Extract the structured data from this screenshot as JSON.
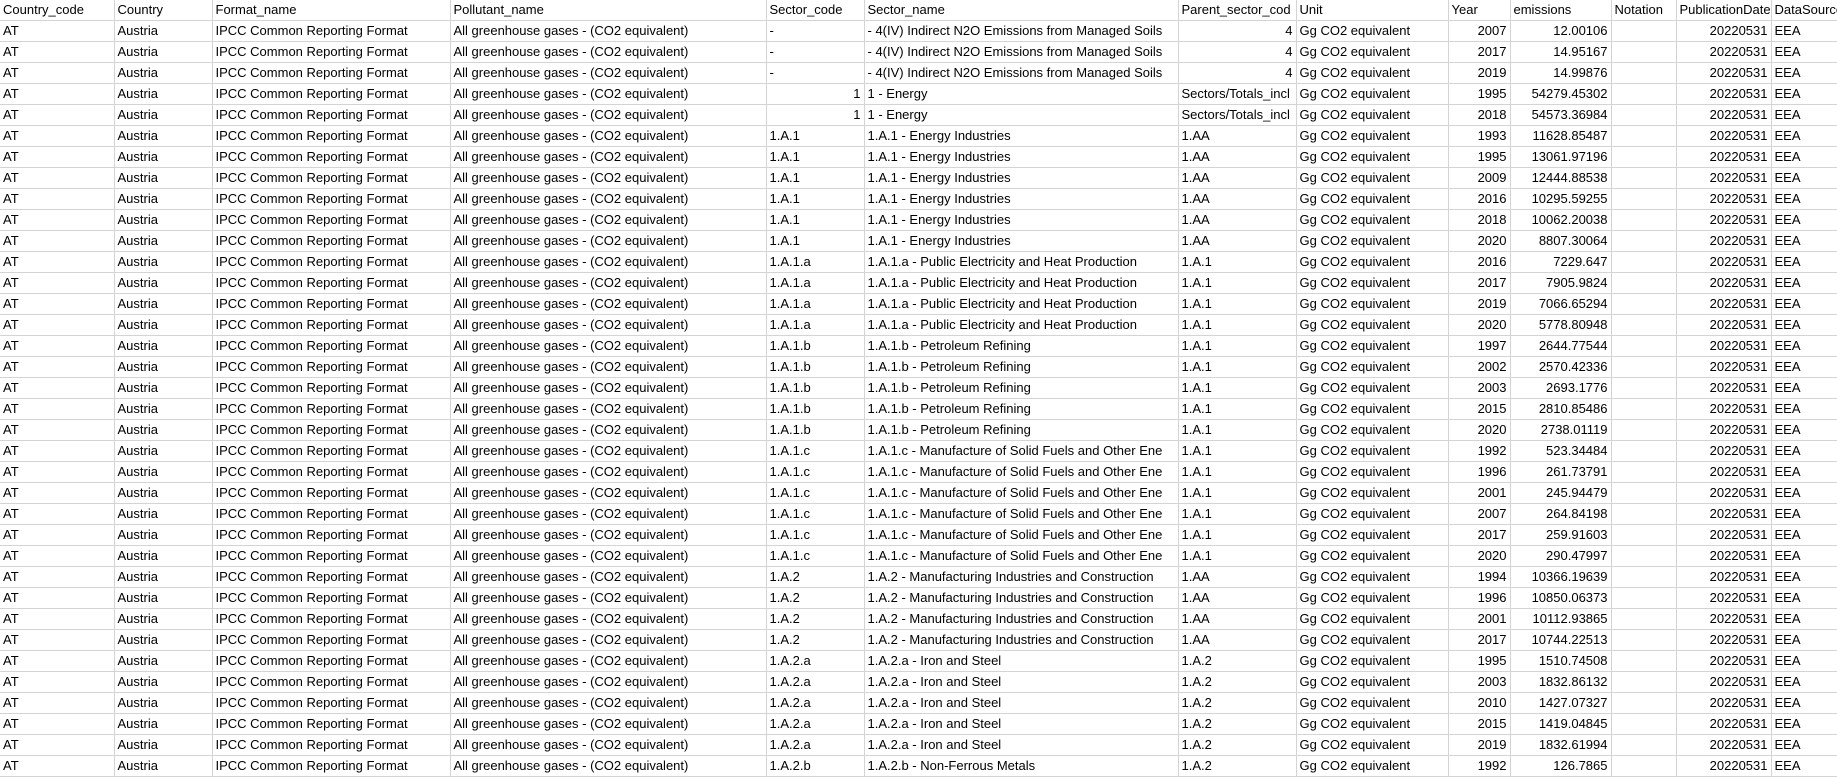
{
  "headers": [
    "Country_code",
    "Country",
    "Format_name",
    "Pollutant_name",
    "Sector_code",
    "Sector_name",
    "Parent_sector_cod",
    "Unit",
    "Year",
    "emissions",
    "Notation",
    "PublicationDate",
    "DataSource"
  ],
  "rows": [
    [
      "AT",
      "Austria",
      "IPCC Common Reporting Format",
      "All greenhouse gases - (CO2 equivalent)",
      "-",
      "- 4(IV)  Indirect N2O Emissions from Managed Soils",
      "4",
      "Gg CO2 equivalent",
      "2007",
      "12.00106",
      "",
      "20220531",
      "EEA"
    ],
    [
      "AT",
      "Austria",
      "IPCC Common Reporting Format",
      "All greenhouse gases - (CO2 equivalent)",
      "-",
      "- 4(IV)  Indirect N2O Emissions from Managed Soils",
      "4",
      "Gg CO2 equivalent",
      "2017",
      "14.95167",
      "",
      "20220531",
      "EEA"
    ],
    [
      "AT",
      "Austria",
      "IPCC Common Reporting Format",
      "All greenhouse gases - (CO2 equivalent)",
      "-",
      "- 4(IV)  Indirect N2O Emissions from Managed Soils",
      "4",
      "Gg CO2 equivalent",
      "2019",
      "14.99876",
      "",
      "20220531",
      "EEA"
    ],
    [
      "AT",
      "Austria",
      "IPCC Common Reporting Format",
      "All greenhouse gases - (CO2 equivalent)",
      "1",
      "1 - Energy",
      "Sectors/Totals_incl",
      "Gg CO2 equivalent",
      "1995",
      "54279.45302",
      "",
      "20220531",
      "EEA"
    ],
    [
      "AT",
      "Austria",
      "IPCC Common Reporting Format",
      "All greenhouse gases - (CO2 equivalent)",
      "1",
      "1 - Energy",
      "Sectors/Totals_incl",
      "Gg CO2 equivalent",
      "2018",
      "54573.36984",
      "",
      "20220531",
      "EEA"
    ],
    [
      "AT",
      "Austria",
      "IPCC Common Reporting Format",
      "All greenhouse gases - (CO2 equivalent)",
      "1.A.1",
      "1.A.1 - Energy Industries",
      "1.AA",
      "Gg CO2 equivalent",
      "1993",
      "11628.85487",
      "",
      "20220531",
      "EEA"
    ],
    [
      "AT",
      "Austria",
      "IPCC Common Reporting Format",
      "All greenhouse gases - (CO2 equivalent)",
      "1.A.1",
      "1.A.1 - Energy Industries",
      "1.AA",
      "Gg CO2 equivalent",
      "1995",
      "13061.97196",
      "",
      "20220531",
      "EEA"
    ],
    [
      "AT",
      "Austria",
      "IPCC Common Reporting Format",
      "All greenhouse gases - (CO2 equivalent)",
      "1.A.1",
      "1.A.1 - Energy Industries",
      "1.AA",
      "Gg CO2 equivalent",
      "2009",
      "12444.88538",
      "",
      "20220531",
      "EEA"
    ],
    [
      "AT",
      "Austria",
      "IPCC Common Reporting Format",
      "All greenhouse gases - (CO2 equivalent)",
      "1.A.1",
      "1.A.1 - Energy Industries",
      "1.AA",
      "Gg CO2 equivalent",
      "2016",
      "10295.59255",
      "",
      "20220531",
      "EEA"
    ],
    [
      "AT",
      "Austria",
      "IPCC Common Reporting Format",
      "All greenhouse gases - (CO2 equivalent)",
      "1.A.1",
      "1.A.1 - Energy Industries",
      "1.AA",
      "Gg CO2 equivalent",
      "2018",
      "10062.20038",
      "",
      "20220531",
      "EEA"
    ],
    [
      "AT",
      "Austria",
      "IPCC Common Reporting Format",
      "All greenhouse gases - (CO2 equivalent)",
      "1.A.1",
      "1.A.1 - Energy Industries",
      "1.AA",
      "Gg CO2 equivalent",
      "2020",
      "8807.30064",
      "",
      "20220531",
      "EEA"
    ],
    [
      "AT",
      "Austria",
      "IPCC Common Reporting Format",
      "All greenhouse gases - (CO2 equivalent)",
      "1.A.1.a",
      "1.A.1.a - Public Electricity and Heat Production",
      "1.A.1",
      "Gg CO2 equivalent",
      "2016",
      "7229.647",
      "",
      "20220531",
      "EEA"
    ],
    [
      "AT",
      "Austria",
      "IPCC Common Reporting Format",
      "All greenhouse gases - (CO2 equivalent)",
      "1.A.1.a",
      "1.A.1.a - Public Electricity and Heat Production",
      "1.A.1",
      "Gg CO2 equivalent",
      "2017",
      "7905.9824",
      "",
      "20220531",
      "EEA"
    ],
    [
      "AT",
      "Austria",
      "IPCC Common Reporting Format",
      "All greenhouse gases - (CO2 equivalent)",
      "1.A.1.a",
      "1.A.1.a - Public Electricity and Heat Production",
      "1.A.1",
      "Gg CO2 equivalent",
      "2019",
      "7066.65294",
      "",
      "20220531",
      "EEA"
    ],
    [
      "AT",
      "Austria",
      "IPCC Common Reporting Format",
      "All greenhouse gases - (CO2 equivalent)",
      "1.A.1.a",
      "1.A.1.a - Public Electricity and Heat Production",
      "1.A.1",
      "Gg CO2 equivalent",
      "2020",
      "5778.80948",
      "",
      "20220531",
      "EEA"
    ],
    [
      "AT",
      "Austria",
      "IPCC Common Reporting Format",
      "All greenhouse gases - (CO2 equivalent)",
      "1.A.1.b",
      "1.A.1.b - Petroleum Refining",
      "1.A.1",
      "Gg CO2 equivalent",
      "1997",
      "2644.77544",
      "",
      "20220531",
      "EEA"
    ],
    [
      "AT",
      "Austria",
      "IPCC Common Reporting Format",
      "All greenhouse gases - (CO2 equivalent)",
      "1.A.1.b",
      "1.A.1.b - Petroleum Refining",
      "1.A.1",
      "Gg CO2 equivalent",
      "2002",
      "2570.42336",
      "",
      "20220531",
      "EEA"
    ],
    [
      "AT",
      "Austria",
      "IPCC Common Reporting Format",
      "All greenhouse gases - (CO2 equivalent)",
      "1.A.1.b",
      "1.A.1.b - Petroleum Refining",
      "1.A.1",
      "Gg CO2 equivalent",
      "2003",
      "2693.1776",
      "",
      "20220531",
      "EEA"
    ],
    [
      "AT",
      "Austria",
      "IPCC Common Reporting Format",
      "All greenhouse gases - (CO2 equivalent)",
      "1.A.1.b",
      "1.A.1.b - Petroleum Refining",
      "1.A.1",
      "Gg CO2 equivalent",
      "2015",
      "2810.85486",
      "",
      "20220531",
      "EEA"
    ],
    [
      "AT",
      "Austria",
      "IPCC Common Reporting Format",
      "All greenhouse gases - (CO2 equivalent)",
      "1.A.1.b",
      "1.A.1.b - Petroleum Refining",
      "1.A.1",
      "Gg CO2 equivalent",
      "2020",
      "2738.01119",
      "",
      "20220531",
      "EEA"
    ],
    [
      "AT",
      "Austria",
      "IPCC Common Reporting Format",
      "All greenhouse gases - (CO2 equivalent)",
      "1.A.1.c",
      "1.A.1.c - Manufacture of Solid Fuels and Other Ene",
      "1.A.1",
      "Gg CO2 equivalent",
      "1992",
      "523.34484",
      "",
      "20220531",
      "EEA"
    ],
    [
      "AT",
      "Austria",
      "IPCC Common Reporting Format",
      "All greenhouse gases - (CO2 equivalent)",
      "1.A.1.c",
      "1.A.1.c - Manufacture of Solid Fuels and Other Ene",
      "1.A.1",
      "Gg CO2 equivalent",
      "1996",
      "261.73791",
      "",
      "20220531",
      "EEA"
    ],
    [
      "AT",
      "Austria",
      "IPCC Common Reporting Format",
      "All greenhouse gases - (CO2 equivalent)",
      "1.A.1.c",
      "1.A.1.c - Manufacture of Solid Fuels and Other Ene",
      "1.A.1",
      "Gg CO2 equivalent",
      "2001",
      "245.94479",
      "",
      "20220531",
      "EEA"
    ],
    [
      "AT",
      "Austria",
      "IPCC Common Reporting Format",
      "All greenhouse gases - (CO2 equivalent)",
      "1.A.1.c",
      "1.A.1.c - Manufacture of Solid Fuels and Other Ene",
      "1.A.1",
      "Gg CO2 equivalent",
      "2007",
      "264.84198",
      "",
      "20220531",
      "EEA"
    ],
    [
      "AT",
      "Austria",
      "IPCC Common Reporting Format",
      "All greenhouse gases - (CO2 equivalent)",
      "1.A.1.c",
      "1.A.1.c - Manufacture of Solid Fuels and Other Ene",
      "1.A.1",
      "Gg CO2 equivalent",
      "2017",
      "259.91603",
      "",
      "20220531",
      "EEA"
    ],
    [
      "AT",
      "Austria",
      "IPCC Common Reporting Format",
      "All greenhouse gases - (CO2 equivalent)",
      "1.A.1.c",
      "1.A.1.c - Manufacture of Solid Fuels and Other Ene",
      "1.A.1",
      "Gg CO2 equivalent",
      "2020",
      "290.47997",
      "",
      "20220531",
      "EEA"
    ],
    [
      "AT",
      "Austria",
      "IPCC Common Reporting Format",
      "All greenhouse gases - (CO2 equivalent)",
      "1.A.2",
      "1.A.2 - Manufacturing Industries and Construction",
      "1.AA",
      "Gg CO2 equivalent",
      "1994",
      "10366.19639",
      "",
      "20220531",
      "EEA"
    ],
    [
      "AT",
      "Austria",
      "IPCC Common Reporting Format",
      "All greenhouse gases - (CO2 equivalent)",
      "1.A.2",
      "1.A.2 - Manufacturing Industries and Construction",
      "1.AA",
      "Gg CO2 equivalent",
      "1996",
      "10850.06373",
      "",
      "20220531",
      "EEA"
    ],
    [
      "AT",
      "Austria",
      "IPCC Common Reporting Format",
      "All greenhouse gases - (CO2 equivalent)",
      "1.A.2",
      "1.A.2 - Manufacturing Industries and Construction",
      "1.AA",
      "Gg CO2 equivalent",
      "2001",
      "10112.93865",
      "",
      "20220531",
      "EEA"
    ],
    [
      "AT",
      "Austria",
      "IPCC Common Reporting Format",
      "All greenhouse gases - (CO2 equivalent)",
      "1.A.2",
      "1.A.2 - Manufacturing Industries and Construction",
      "1.AA",
      "Gg CO2 equivalent",
      "2017",
      "10744.22513",
      "",
      "20220531",
      "EEA"
    ],
    [
      "AT",
      "Austria",
      "IPCC Common Reporting Format",
      "All greenhouse gases - (CO2 equivalent)",
      "1.A.2.a",
      "1.A.2.a - Iron and Steel",
      "1.A.2",
      "Gg CO2 equivalent",
      "1995",
      "1510.74508",
      "",
      "20220531",
      "EEA"
    ],
    [
      "AT",
      "Austria",
      "IPCC Common Reporting Format",
      "All greenhouse gases - (CO2 equivalent)",
      "1.A.2.a",
      "1.A.2.a - Iron and Steel",
      "1.A.2",
      "Gg CO2 equivalent",
      "2003",
      "1832.86132",
      "",
      "20220531",
      "EEA"
    ],
    [
      "AT",
      "Austria",
      "IPCC Common Reporting Format",
      "All greenhouse gases - (CO2 equivalent)",
      "1.A.2.a",
      "1.A.2.a - Iron and Steel",
      "1.A.2",
      "Gg CO2 equivalent",
      "2010",
      "1427.07327",
      "",
      "20220531",
      "EEA"
    ],
    [
      "AT",
      "Austria",
      "IPCC Common Reporting Format",
      "All greenhouse gases - (CO2 equivalent)",
      "1.A.2.a",
      "1.A.2.a - Iron and Steel",
      "1.A.2",
      "Gg CO2 equivalent",
      "2015",
      "1419.04845",
      "",
      "20220531",
      "EEA"
    ],
    [
      "AT",
      "Austria",
      "IPCC Common Reporting Format",
      "All greenhouse gases - (CO2 equivalent)",
      "1.A.2.a",
      "1.A.2.a - Iron and Steel",
      "1.A.2",
      "Gg CO2 equivalent",
      "2019",
      "1832.61994",
      "",
      "20220531",
      "EEA"
    ],
    [
      "AT",
      "Austria",
      "IPCC Common Reporting Format",
      "All greenhouse gases - (CO2 equivalent)",
      "1.A.2.b",
      "1.A.2.b - Non-Ferrous Metals",
      "1.A.2",
      "Gg CO2 equivalent",
      "1992",
      "126.7865",
      "",
      "20220531",
      "EEA"
    ]
  ]
}
